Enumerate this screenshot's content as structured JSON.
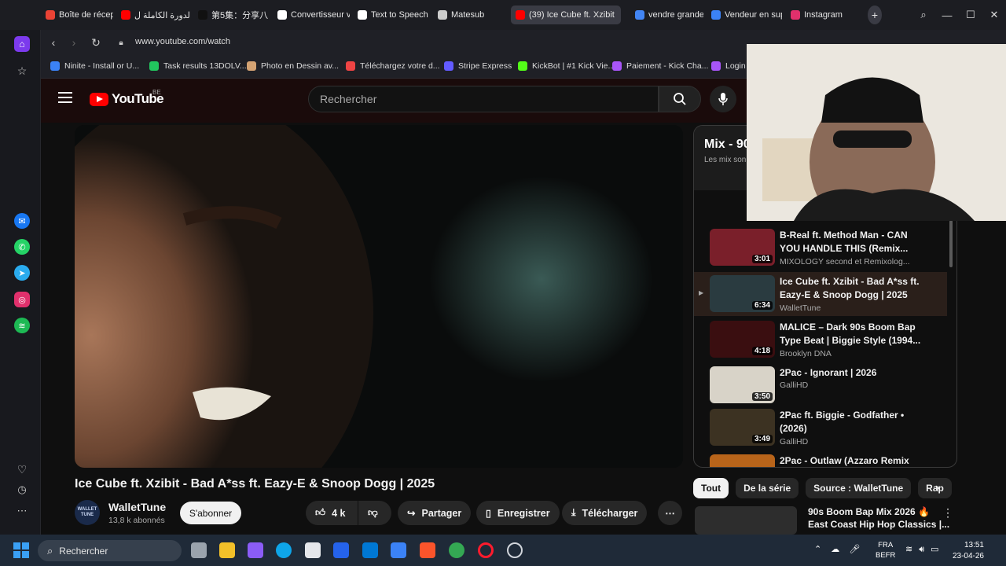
{
  "browser": {
    "tabs": [
      {
        "label": "Boîte de récepti",
        "color": "#ea4335"
      },
      {
        "label": "الدورة الكاملة ل",
        "color": "#ff0000"
      },
      {
        "label": "第5集：分享八",
        "color": "#111111"
      },
      {
        "label": "Convertisseur vi",
        "color": "#ffffff"
      },
      {
        "label": "Text to Speech |",
        "color": "#ffffff"
      },
      {
        "label": "Matesub",
        "color": "#cccccc"
      },
      {
        "label": "(39) Ice Cube ft. Xzibit",
        "color": "#ff0000"
      },
      {
        "label": "vendre grande s",
        "color": "#4285f4"
      },
      {
        "label": "Vendeur en sup",
        "color": "#3b82f6"
      },
      {
        "label": "Instagram",
        "color": "#e1306c"
      }
    ],
    "url": "www.youtube.com/watch",
    "bookmarks": [
      {
        "label": "Ninite - Install or U...",
        "color": "#3b82f6"
      },
      {
        "label": "Task results 13DOLV...",
        "color": "#22c55e"
      },
      {
        "label": "Photo en Dessin av...",
        "color": "#d4a373"
      },
      {
        "label": "Téléchargez votre d...",
        "color": "#ef4444"
      },
      {
        "label": "Stripe Express",
        "color": "#635bff"
      },
      {
        "label": "KickBot | #1 Kick Vie...",
        "color": "#53fc18"
      },
      {
        "label": "Paiement - Kick Cha...",
        "color": "#a855f7"
      },
      {
        "label": "Login",
        "color": "#a855f7"
      }
    ]
  },
  "youtube": {
    "brand": "YouTube",
    "country": "BE",
    "search_placeholder": "Rechercher",
    "video_title": "Ice Cube ft. Xzibit - Bad A*ss ft. Eazy-E & Snoop Dogg | 2025",
    "channel": {
      "name": "WalletTune",
      "subscribers": "13,8 k abonnés",
      "avatar_text": "WALLET TUNE"
    },
    "subscribe": "S'abonner",
    "actions": {
      "likes": "4 k",
      "share": "Partager",
      "save": "Enregistrer",
      "download": "Télécharger"
    },
    "playlist": {
      "title": "Mix - 90",
      "subtitle": "Les mix son",
      "items": [
        {
          "title": "B-Real ft. Method Man - CAN YOU HANDLE THIS (Remix...",
          "channel": "MIXOLOGY second et Remixolog...",
          "duration": "3:01",
          "thumb": "#7a1f2a"
        },
        {
          "title": "Ice Cube ft. Xzibit - Bad A*ss ft. Eazy-E & Snoop Dogg | 2025",
          "channel": "WalletTune",
          "duration": "6:34",
          "thumb": "#2a3b40",
          "current": true
        },
        {
          "title": "MALICE – Dark 90s Boom Bap Type Beat | Biggie Style (1994...",
          "channel": "Brooklyn DNA",
          "duration": "4:18",
          "thumb": "#3a0e10"
        },
        {
          "title": "2Pac - Ignorant | 2026",
          "channel": "GalliHD",
          "duration": "3:50",
          "thumb": "#d8d3c8"
        },
        {
          "title": "2Pac ft. Biggie - Godfather • (2026)",
          "channel": "GalliHD",
          "duration": "3:49",
          "thumb": "#3c3222"
        },
        {
          "title": "2Pac - Outlaw (Azzaro Remix",
          "channel": "",
          "duration": "",
          "thumb": "#b8641a"
        }
      ]
    },
    "chips": [
      "Tout",
      "De la série",
      "Source : WalletTune",
      "Rap"
    ],
    "next_item": {
      "title": "90s Boom Bap Mix 2026 🔥",
      "subtitle": "East Coast Hip Hop Classics |..."
    }
  },
  "taskbar": {
    "search": "Rechercher",
    "lang_line1": "FRA",
    "lang_line2": "BEFR",
    "time": "13:51",
    "date": "23-04-26"
  }
}
